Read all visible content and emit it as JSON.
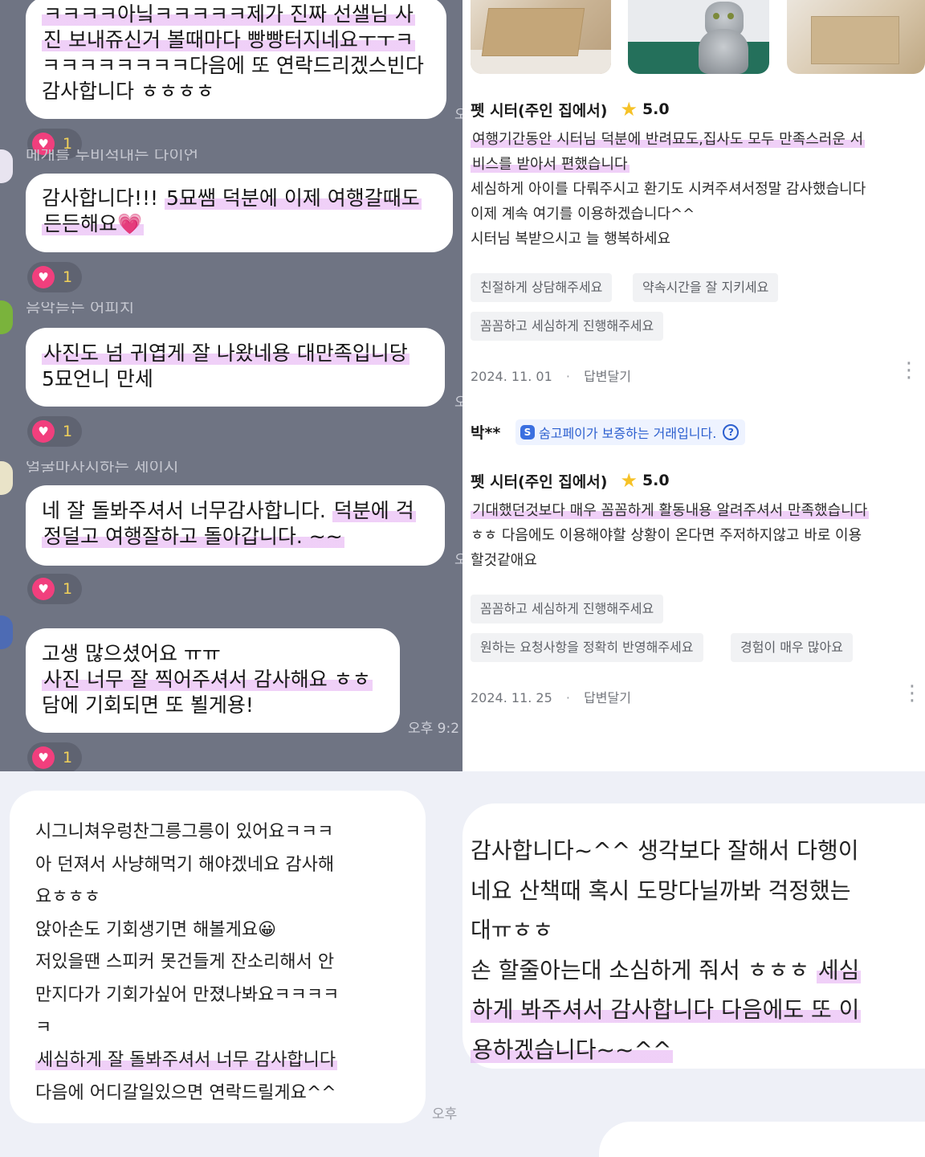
{
  "chat": {
    "messages": [
      {
        "lines": [
          [
            {
              "t": "ㅋㅋㅋㅋ아닠ㅋㅋㅋㅋㅋ제가 진짜 선샐님 사",
              "h": true
            }
          ],
          [
            {
              "t": "진 보내쥬신거 볼때마다 빵빵터지네요ㅜㅜㅋ",
              "h": true
            }
          ],
          [
            {
              "t": "ㅋㅋㅋㅋㅋㅋㅋㅋ다음에 또 연락드리겠스빈다",
              "h": false
            }
          ],
          [
            {
              "t": "감사합니다 ㅎㅎㅎㅎ",
              "h": false
            }
          ]
        ]
      },
      {
        "lines": [
          [
            {
              "t": "감사합니다!!! ",
              "h": false
            },
            {
              "t": "5묘쌤 덕분에 이제 여행갈때도",
              "h": true
            }
          ],
          [
            {
              "t": "든든해요💗",
              "h": true
            }
          ]
        ]
      },
      {
        "lines": [
          [
            {
              "t": "사진도 넘 귀엽게 잘 나왔네용 대만족입니당",
              "h": true
            }
          ],
          [
            {
              "t": "5묘언니 만세",
              "h": false
            }
          ]
        ]
      },
      {
        "lines": [
          [
            {
              "t": "네 잘 돌봐주셔서 너무감사합니다. ",
              "h": false
            },
            {
              "t": "덕분에 걱",
              "h": true
            }
          ],
          [
            {
              "t": "정덜고 여행잘하고 돌아갑니다. ~~",
              "h": true
            }
          ]
        ]
      },
      {
        "lines": [
          [
            {
              "t": "고생 많으셨어요 ㅠㅠ",
              "h": false
            }
          ],
          [
            {
              "t": "사진 너무 잘 찍어주셔서 감사해요 ㅎㅎ",
              "h": true
            }
          ],
          [
            {
              "t": "담에 기회되면 또 뵐게용!",
              "h": false
            }
          ]
        ]
      }
    ],
    "reaction": {
      "icon": "heart-icon",
      "count": "1"
    },
    "ghost_lines": [
      "메개를 누비적내는 다이언",
      "음악듣는 어피치",
      "얼굴마사시하는 세이시"
    ],
    "time_partial": "오후 9:2",
    "time_edge": "오"
  },
  "reviews": {
    "items": [
      {
        "service": "펫 시터(주인 집에서)",
        "rating": "5.0",
        "text_lines": [
          [
            {
              "t": "여행기간동안 시터님 덕분에 반려묘도,집사도 모두 만족스러운 서",
              "h": true
            }
          ],
          [
            {
              "t": "비스를 받아서 편했습니다",
              "h": true
            }
          ],
          [
            {
              "t": "세심하게 아이를 다뤄주시고 환기도 시켜주셔서정말 감사했습니다",
              "h": false
            }
          ],
          [
            {
              "t": "이제 계속 여기를 이용하겠습니다^^",
              "h": false
            }
          ],
          [
            {
              "t": "시터님 복받으시고 늘 행복하세요",
              "h": false
            }
          ]
        ],
        "tags": [
          "친절하게 상담해주세요",
          "약속시간을 잘 지키세요",
          "꼼꼼하고 세심하게 진행해주세요"
        ],
        "date": "2024. 11. 01",
        "reply": "답변달기"
      },
      {
        "author": "박**",
        "badge": "숨고페이가 보증하는 거래입니다.",
        "service": "펫 시터(주인 집에서)",
        "rating": "5.0",
        "text_lines": [
          [
            {
              "t": "기대했던것보다 매우 꼼꼼하게 활동내용 알려주셔서 만족했습니다",
              "h": true
            }
          ],
          [
            {
              "t": "ㅎㅎ 다음에도 이용해야할 상황이 온다면 주저하지않고 바로 이용",
              "h": false
            }
          ],
          [
            {
              "t": "할것같애요",
              "h": false
            }
          ]
        ],
        "tags": [
          "꼼꼼하고 세심하게 진행해주세요",
          "원하는 요청사항을 정확히 반영해주세요",
          "경험이 매우 많아요"
        ],
        "date": "2024. 11. 25",
        "reply": "답변달기"
      }
    ]
  },
  "bottom_left": {
    "lines": [
      [
        {
          "t": "시그니쳐우렁찬그릉그릉이 있어요ㅋㅋㅋ",
          "h": false
        }
      ],
      [
        {
          "t": "아 던져서 사냥해먹기 해야겠네요 감사해",
          "h": false
        }
      ],
      [
        {
          "t": "요ㅎㅎㅎ",
          "h": false
        }
      ],
      [
        {
          "t": "앉아손도 기회생기면 해볼게요😀",
          "h": false
        }
      ],
      [
        {
          "t": "저있을땐 스피커 못건들게 잔소리해서 안",
          "h": false
        }
      ],
      [
        {
          "t": "만지다가 기회가싶어 만졌나봐요ㅋㅋㅋㅋ",
          "h": false
        }
      ],
      [
        {
          "t": "ㅋ",
          "h": false
        }
      ],
      [
        {
          "t": "세심하게 잘 돌봐주셔서 너무 감사합니다",
          "h": true
        }
      ],
      [
        {
          "t": "다음에 어디갈일있으면 연락드릴게요^^",
          "h": false
        }
      ]
    ],
    "time": "오후"
  },
  "bottom_right": {
    "lines": [
      [
        {
          "t": "감사합니다~^^ 생각보다 잘해서 다행이",
          "h": false
        }
      ],
      [
        {
          "t": "네요 산책때 혹시 도망다닐까봐 걱정했는",
          "h": false
        }
      ],
      [
        {
          "t": "대ㅠㅎㅎ",
          "h": false
        }
      ],
      [
        {
          "t": "손 할줄아는대 소심하게 줘서 ㅎㅎㅎ ",
          "h": false
        },
        {
          "t": "세심",
          "h": true
        }
      ],
      [
        {
          "t": "하게 봐주셔서 감사합니다 다음에도 또 이",
          "h": true
        }
      ],
      [
        {
          "t": "용하겠습니다~~^^",
          "h": true
        }
      ]
    ]
  },
  "colors": {
    "chat_bg": "#6f7483",
    "highlight": "#d682eb",
    "heart": "#f13f7d",
    "star": "#f6c227",
    "count": "#f2d25a",
    "badge": "#2c5fcf"
  }
}
